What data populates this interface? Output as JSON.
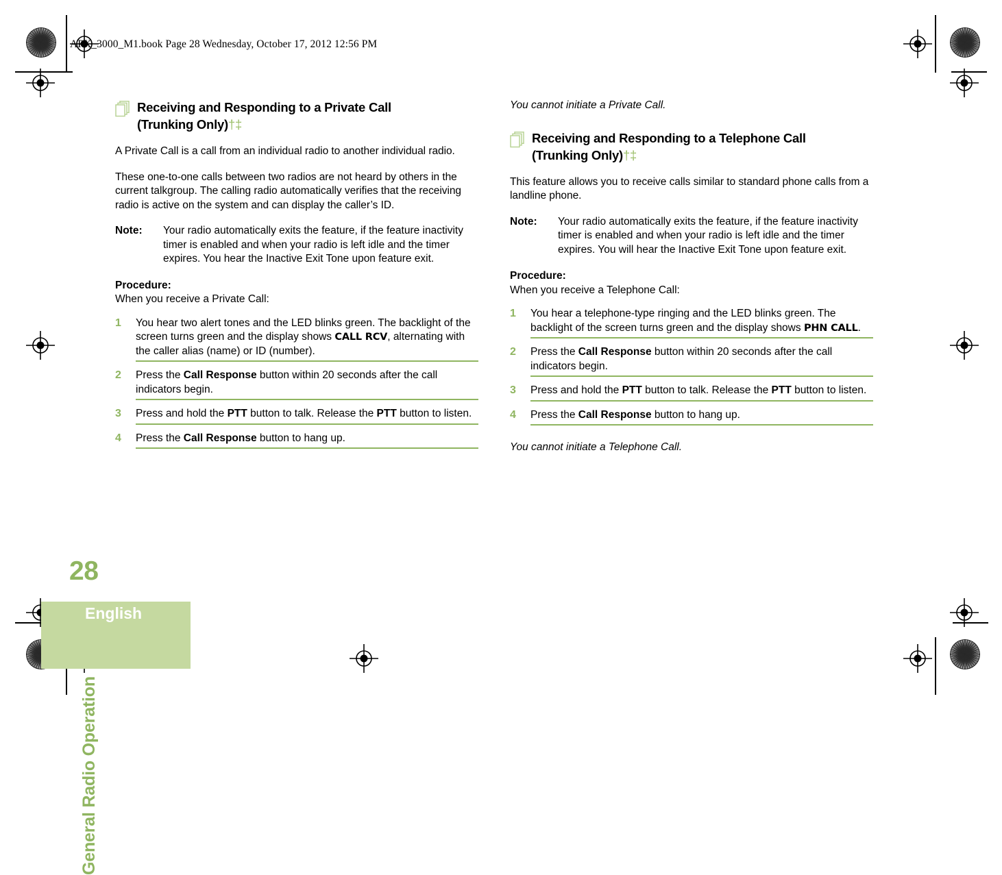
{
  "page": {
    "header_slug": "APX_3000_M1.book  Page 28  Wednesday, October 17, 2012  12:56 PM",
    "chapter_title": "General Radio Operation",
    "folio": "28",
    "language": "English",
    "accent_green": "#8fb560",
    "accent_green_light": "#c5d9a0",
    "dagger_marks": "†‡"
  },
  "left_column": {
    "heading_line1": "Receiving and Responding to a Private Call",
    "heading_line2": "(Trunking Only)",
    "heading_marks": "†‡",
    "icon": "pages-icon",
    "paragraph_1": "A Private Call is a call from an individual radio to another individual radio.",
    "paragraph_2": "These one-to-one calls between two radios are not heard by others in the current talkgroup. The calling radio automatically verifies that the receiving radio is active on the system and can display the caller’s ID.",
    "note_label": "Note:",
    "note_text": "Your radio automatically exits the feature, if the feature inactivity timer is enabled and when your radio is left idle and the timer expires. You hear the Inactive Exit Tone upon feature exit.",
    "procedure_label": "Procedure:",
    "procedure_intro": "When you receive a Private Call:",
    "steps": [
      {
        "num": "1",
        "parts": [
          {
            "t": "You hear two alert tones and the LED blinks green. The backlight of the screen turns green and the display shows ",
            "s": "plain"
          },
          {
            "t": "CALL RCV",
            "s": "display"
          },
          {
            "t": ", alternating with the caller alias (name) or ID (number).",
            "s": "plain"
          }
        ]
      },
      {
        "num": "2",
        "parts": [
          {
            "t": "Press the ",
            "s": "plain"
          },
          {
            "t": "Call Response",
            "s": "bold"
          },
          {
            "t": " button within 20 seconds after the call indicators begin.",
            "s": "plain"
          }
        ]
      },
      {
        "num": "3",
        "parts": [
          {
            "t": "Press and hold the ",
            "s": "plain"
          },
          {
            "t": "PTT",
            "s": "bold"
          },
          {
            "t": " button to talk. Release the ",
            "s": "plain"
          },
          {
            "t": "PTT",
            "s": "bold"
          },
          {
            "t": " button to listen.",
            "s": "plain"
          }
        ]
      },
      {
        "num": "4",
        "parts": [
          {
            "t": "Press the ",
            "s": "plain"
          },
          {
            "t": "Call Response",
            "s": "bold"
          },
          {
            "t": " button to hang up.",
            "s": "plain"
          }
        ]
      }
    ]
  },
  "right_column": {
    "lead_italic": "You cannot initiate a Private Call.",
    "heading_line1": "Receiving and Responding to a Telephone Call",
    "heading_line2": "(Trunking Only)",
    "heading_marks": "†‡",
    "icon": "pages-icon",
    "paragraph_1": "This feature allows you to receive calls similar to standard phone calls from a landline phone.",
    "note_label": "Note:",
    "note_text": "Your radio automatically exits the feature, if the feature inactivity timer is enabled and when your radio is left idle and the timer expires. You will hear the Inactive Exit Tone upon feature exit.",
    "procedure_label": "Procedure:",
    "procedure_intro": "When you receive a Telephone Call:",
    "steps": [
      {
        "num": "1",
        "parts": [
          {
            "t": "You hear a telephone-type ringing and the LED blinks green. The backlight of the screen turns green and the display shows ",
            "s": "plain"
          },
          {
            "t": "PHN CALL",
            "s": "display"
          },
          {
            "t": ".",
            "s": "plain"
          }
        ]
      },
      {
        "num": "2",
        "parts": [
          {
            "t": "Press the ",
            "s": "plain"
          },
          {
            "t": "Call Response",
            "s": "bold"
          },
          {
            "t": " button within 20 seconds after the call indicators begin.",
            "s": "plain"
          }
        ]
      },
      {
        "num": "3",
        "parts": [
          {
            "t": "Press and hold the ",
            "s": "plain"
          },
          {
            "t": "PTT",
            "s": "bold"
          },
          {
            "t": " button to talk. Release the ",
            "s": "plain"
          },
          {
            "t": "PTT",
            "s": "bold"
          },
          {
            "t": " button to listen.",
            "s": "plain"
          }
        ]
      },
      {
        "num": "4",
        "parts": [
          {
            "t": "Press the ",
            "s": "plain"
          },
          {
            "t": "Call Response",
            "s": "bold"
          },
          {
            "t": " button to hang up.",
            "s": "plain"
          }
        ]
      }
    ],
    "closing_italic": "You cannot initiate a Telephone Call."
  }
}
